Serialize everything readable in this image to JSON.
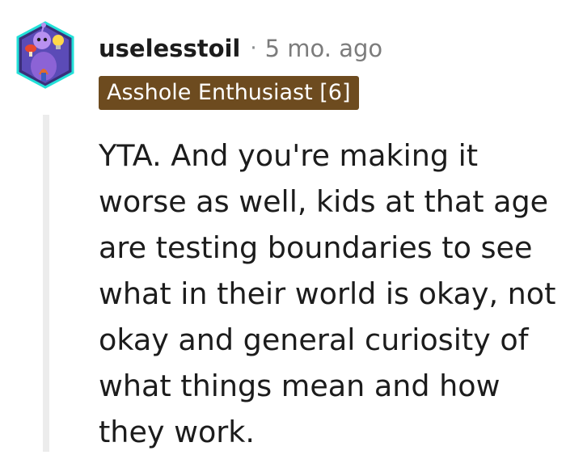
{
  "comment": {
    "username": "uselesstoil",
    "separator": "·",
    "time_ago": "5 mo. ago",
    "flair": "Asshole Enthusiast [6]",
    "body_lines": [
      "YTA. And you're making it",
      "worse as well, kids at that age",
      "are testing boundaries to see",
      "what in their world is okay, not",
      "okay and general curiosity of",
      "what things mean and how",
      "they work."
    ]
  },
  "colors": {
    "flair_background": "#6d4b1f",
    "flair_text": "#ffffff",
    "thread_line": "#ececec",
    "meta_gray": "#7c7c7c"
  },
  "icons": {
    "avatar": "snoo-avatar-icon"
  }
}
